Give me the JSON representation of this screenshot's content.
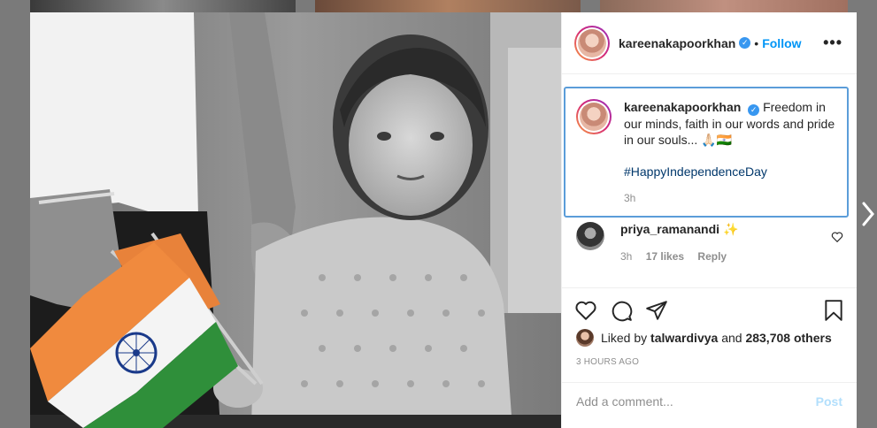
{
  "post": {
    "username": "kareenakapoorkhan",
    "follow_label": "Follow",
    "separator": "•",
    "more_label": "•••",
    "caption": {
      "username": "kareenakapoorkhan",
      "text": "Freedom in our minds, faith in our words and pride in our souls... 🙏🏻🇮🇳",
      "hashtag": "#HappyIndependenceDay",
      "time": "3h"
    },
    "comments": [
      {
        "username": "priya_ramanandi",
        "text": "✨",
        "time": "3h",
        "likes": "17 likes",
        "reply_label": "Reply"
      }
    ],
    "likes": {
      "prefix": "Liked by ",
      "user": "talwardivya",
      "middle": " and ",
      "count": "283,708 others"
    },
    "timestamp": "3 HOURS AGO",
    "add_comment_placeholder": "Add a comment...",
    "post_label": "Post"
  },
  "icons": {
    "verified": "verified-badge-icon",
    "heart": "heart-icon",
    "comment": "comment-icon",
    "share": "share-icon",
    "save": "bookmark-icon",
    "next": "chevron-right-icon"
  },
  "colors": {
    "accent": "#0095f6",
    "caption_border": "#5b9dd9",
    "hashtag": "#00376b"
  }
}
